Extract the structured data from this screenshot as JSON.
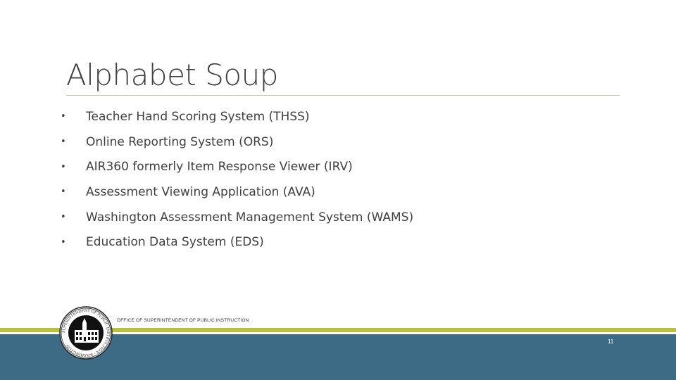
{
  "slide": {
    "title": "Alphabet Soup",
    "bullets": [
      "Teacher Hand Scoring System (THSS)",
      "Online Reporting System (ORS)",
      "AIR360 formerly Item Response Viewer (IRV)",
      "Assessment Viewing Application (AVA)",
      "Washington Assessment Management System (WAMS)",
      "Education Data System (EDS)"
    ],
    "bullet_glyph": "•"
  },
  "footer": {
    "office_name": "OFFICE OF SUPERINTENDENT OF PUBLIC INSTRUCTION",
    "page_number": "11",
    "seal_text": "SUPERINTENDENT OF PUBLIC INSTRUCTION WASHINGTON",
    "colors": {
      "green_band": "#b5c23a",
      "blue_band": "#3d6a84"
    }
  }
}
